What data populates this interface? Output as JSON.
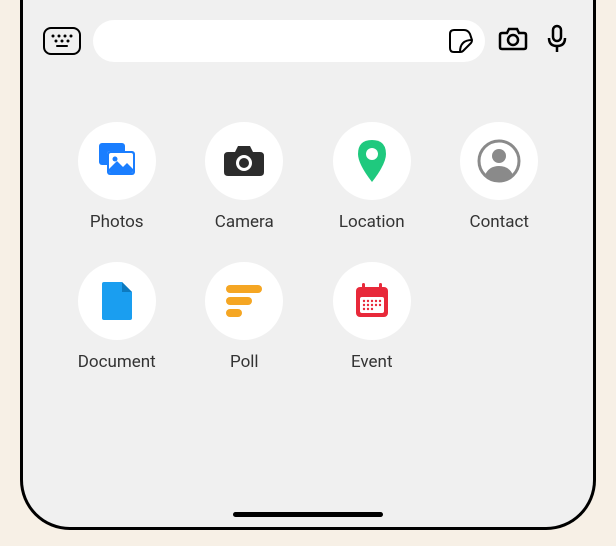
{
  "input": {
    "placeholder": ""
  },
  "attachments": [
    {
      "label": "Photos",
      "icon": "photos-icon"
    },
    {
      "label": "Camera",
      "icon": "camera-icon"
    },
    {
      "label": "Location",
      "icon": "location-icon"
    },
    {
      "label": "Contact",
      "icon": "contact-icon"
    },
    {
      "label": "Document",
      "icon": "document-icon"
    },
    {
      "label": "Poll",
      "icon": "poll-icon"
    },
    {
      "label": "Event",
      "icon": "event-icon"
    }
  ]
}
